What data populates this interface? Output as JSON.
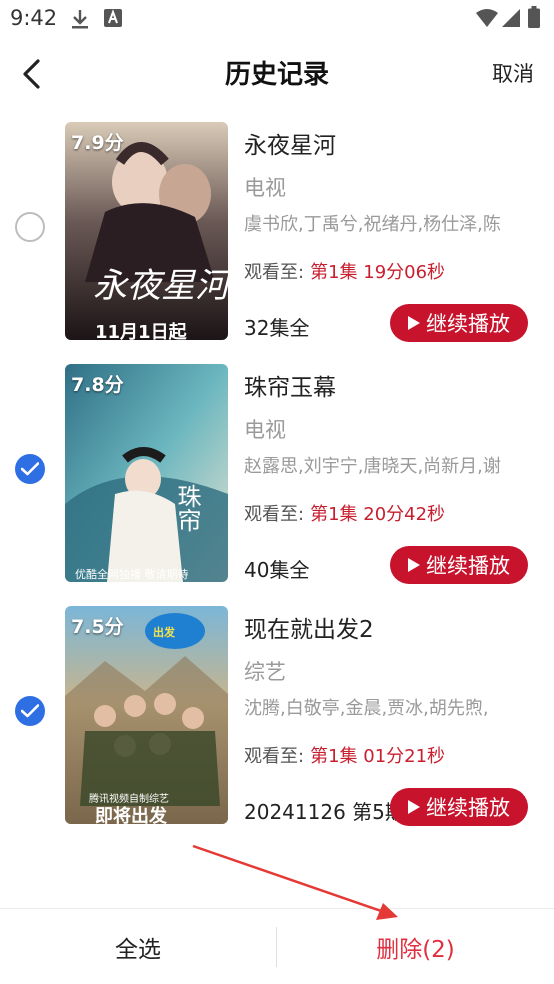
{
  "status_bar": {
    "time": "9:42",
    "icons": [
      "download-icon",
      "a-icon",
      "wifi-icon",
      "signal-icon",
      "battery-icon"
    ]
  },
  "header": {
    "title": "历史记录",
    "cancel_label": "取消"
  },
  "items": [
    {
      "score": "7.9分",
      "title": "永夜星河",
      "category": "电视",
      "cast": "虞书欣,丁禹兮,祝绪丹,杨仕泽,陈",
      "progress_label": "观看至:",
      "progress_value": "第1集 19分06秒",
      "episodes": "32集全",
      "continue_label": "继续播放",
      "selected": false,
      "poster_text": "永夜星河",
      "poster_date": "11月1日起"
    },
    {
      "score": "7.8分",
      "title": "珠帘玉幕",
      "category": "电视",
      "cast": "赵露思,刘宇宁,唐晓天,尚新月,谢",
      "progress_label": "观看至:",
      "progress_value": "第1集 20分42秒",
      "episodes": "40集全",
      "continue_label": "继续播放",
      "selected": true,
      "poster_text": "珠帘玉幕",
      "poster_date": "优酷全网独播 敬请期待"
    },
    {
      "score": "7.5分",
      "title": "现在就出发2",
      "category": "综艺",
      "cast": "沈腾,白敬亭,金晨,贾冰,胡先煦,",
      "progress_label": "观看至:",
      "progress_value": "第1集 01分21秒",
      "episodes": "20241126 第5期",
      "continue_label": "继续播放",
      "selected": true,
      "poster_text": "腾讯视频自制综艺",
      "poster_date": "即将出发"
    }
  ],
  "bottom_bar": {
    "select_all_label": "全选",
    "delete_label": "删除(2)"
  },
  "colors": {
    "accent_red": "#c8132d",
    "delete_red": "#e0303f",
    "check_blue": "#2f6fe4",
    "annotation_arrow": "#e53935"
  }
}
